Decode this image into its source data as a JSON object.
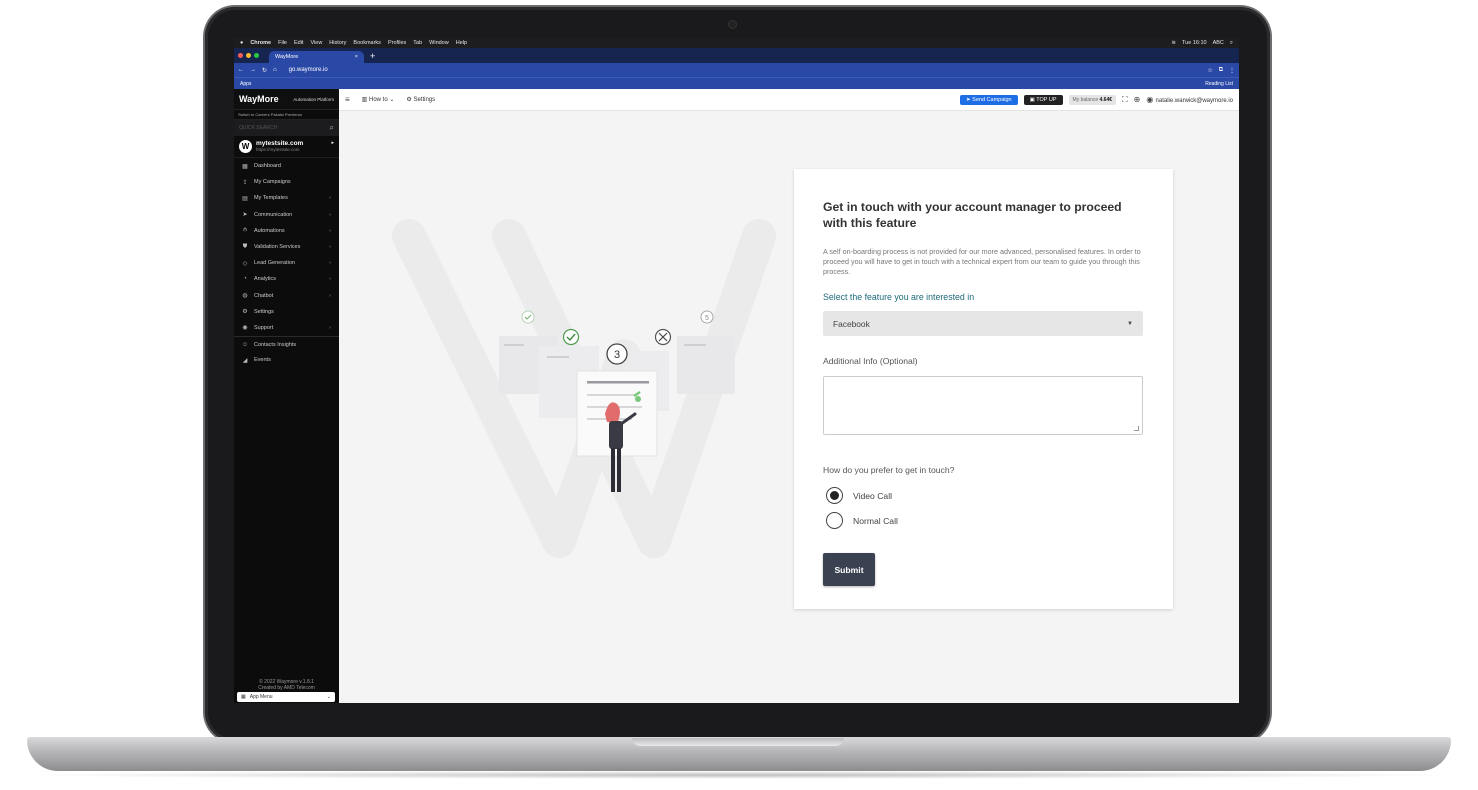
{
  "menubar": {
    "items": [
      "Chrome",
      "File",
      "Edit",
      "View",
      "History",
      "Bookmarks",
      "Profiles",
      "Tab",
      "Window",
      "Help"
    ],
    "clock": "Tue 16:10",
    "input": "ABC"
  },
  "browser": {
    "tab_title": "WayMore",
    "url": "go.waymore.io",
    "apps_label": "Apps",
    "reading_list": "Reading List"
  },
  "sidebar": {
    "brand": "WayMore",
    "platform": "Automation Platform",
    "switch_text": "Switch to Careers Pakatsi Prexteron",
    "quick_search_placeholder": "QUICK SEARCH",
    "site_name": "mytestsite.com",
    "site_url": "https://mytestsite.com",
    "items": [
      {
        "label": "Dashboard",
        "icon": "dashboard-icon",
        "chevron": false
      },
      {
        "label": "My Campaigns",
        "icon": "campaigns-icon",
        "chevron": false
      },
      {
        "label": "My Templates",
        "icon": "templates-icon",
        "chevron": true
      },
      {
        "label": "Communication",
        "icon": "send-icon",
        "chevron": true
      },
      {
        "label": "Automations",
        "icon": "automations-icon",
        "chevron": true
      },
      {
        "label": "Validation Services",
        "icon": "shield-icon",
        "chevron": true
      },
      {
        "label": "Lead Generation",
        "icon": "tag-icon",
        "chevron": true
      },
      {
        "label": "Analytics",
        "icon": "analytics-icon",
        "chevron": true
      },
      {
        "label": "Chatbot",
        "icon": "chatbot-icon",
        "chevron": true
      },
      {
        "label": "Settings",
        "icon": "gear-icon",
        "chevron": false
      },
      {
        "label": "Support",
        "icon": "support-icon",
        "chevron": true
      },
      {
        "label": "Contacts Insights",
        "icon": "contacts-icon",
        "chevron": false
      },
      {
        "label": "Events",
        "icon": "events-icon",
        "chevron": false
      }
    ],
    "footer_line1": "© 2022 Waymore v.1.8.1",
    "footer_line2": "Created by AMD Telecom",
    "app_menu": "App Menu"
  },
  "header": {
    "how_to": "How to",
    "settings": "Settings",
    "send_campaign": "Send Campaign",
    "top_up": "TOP UP",
    "balance_label": "My balance",
    "balance_value": "4.64€",
    "user_email": "natalie.warwick@waymore.io"
  },
  "form": {
    "title": "Get in touch with your account manager to proceed with this feature",
    "description": "A self on-boarding process is not provided for our more advanced, personalised features. In order to proceed you will have to get in touch with a technical expert from our team to guide you through this process.",
    "select_label": "Select the feature you are interested in",
    "select_value": "Facebook",
    "additional_label": "Additional Info (Optional)",
    "contact_label": "How do you prefer to get in touch?",
    "options": [
      "Video Call",
      "Normal Call"
    ],
    "selected_option": "Video Call",
    "submit": "Submit"
  },
  "illustration": {
    "step_number": "3"
  }
}
